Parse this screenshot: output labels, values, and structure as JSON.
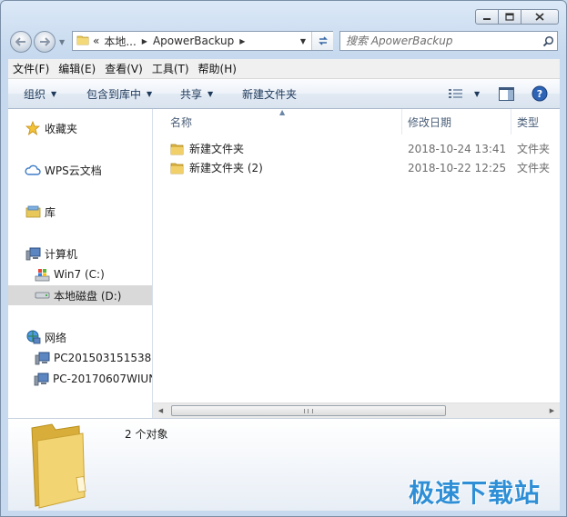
{
  "window": {
    "caption": {
      "minimize": "minimize",
      "maximize": "maximize",
      "close": "close"
    }
  },
  "address": {
    "prefix": "«",
    "crumbs": [
      "本地...",
      "ApowerBackup"
    ],
    "search_placeholder": "搜索 ApowerBackup"
  },
  "menu": [
    "文件(F)",
    "编辑(E)",
    "查看(V)",
    "工具(T)",
    "帮助(H)"
  ],
  "toolbar": {
    "organize": "组织",
    "include_in_library": "包含到库中",
    "share": "共享",
    "new_folder": "新建文件夹"
  },
  "nav": {
    "favorites": "收藏夹",
    "wps": "WPS云文档",
    "libraries": "库",
    "computer": "计算机",
    "drive_c": "Win7 (C:)",
    "drive_d": "本地磁盘 (D:)",
    "network": "网络",
    "pc1": "PC201503151538",
    "pc2": "PC-20170607WIUN"
  },
  "columns": {
    "name": "名称",
    "date": "修改日期",
    "type": "类型"
  },
  "files": [
    {
      "name": "新建文件夹",
      "date": "2018-10-24 13:41",
      "type": "文件夹"
    },
    {
      "name": "新建文件夹 (2)",
      "date": "2018-10-22 12:25",
      "type": "文件夹"
    }
  ],
  "details": {
    "count": "2 个对象"
  },
  "watermark": "极速下载站",
  "colors": {
    "accent": "#1e395b",
    "folder": "#e8c85a",
    "watermark": "#2f8fd6"
  }
}
